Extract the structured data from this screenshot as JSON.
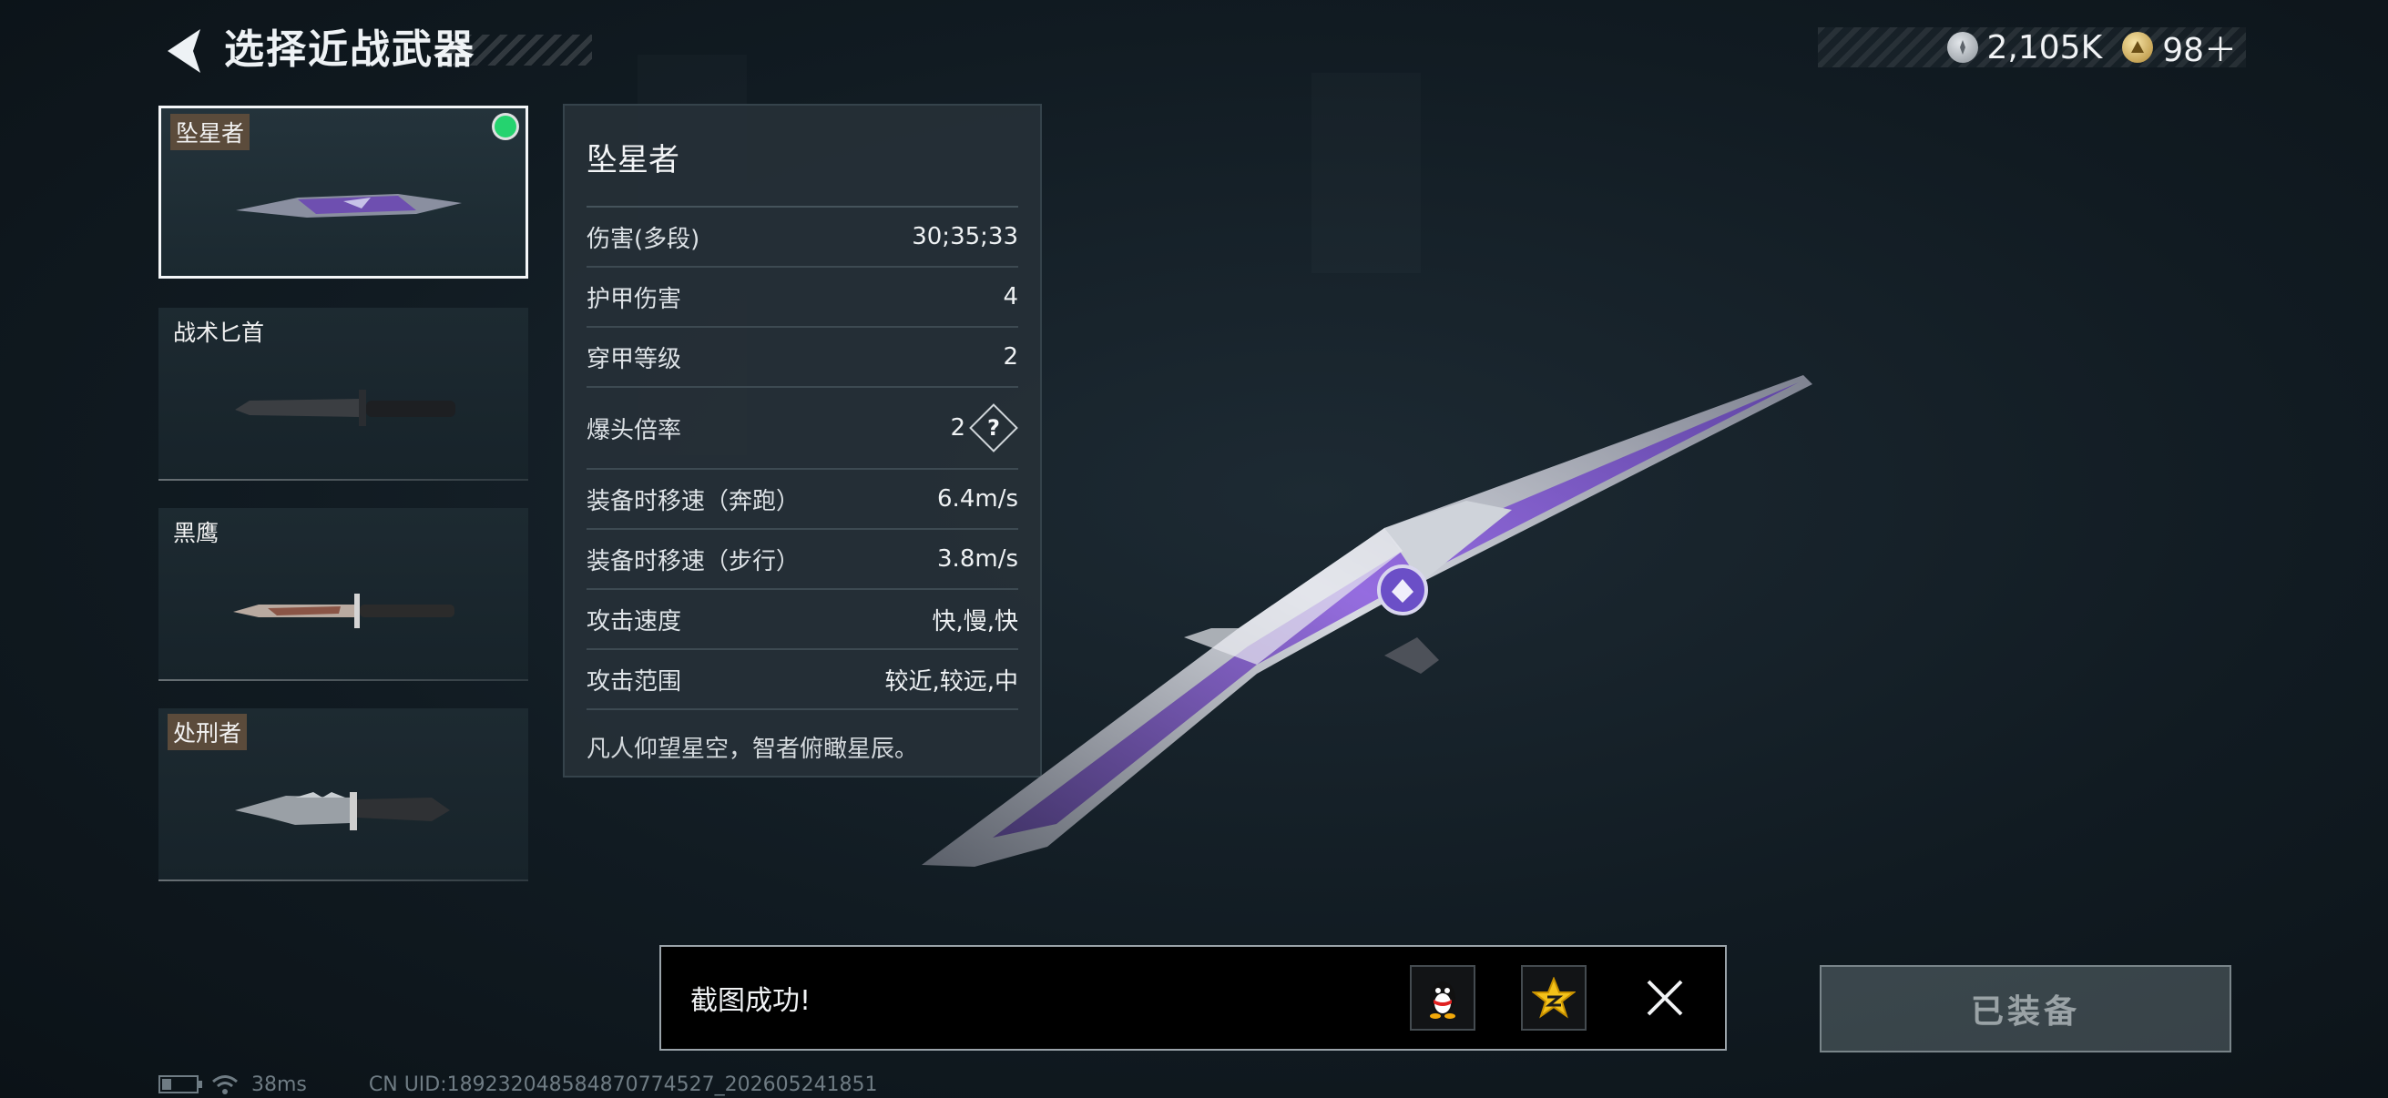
{
  "header": {
    "title": "选择近战武器",
    "back_icon": "back-arrow-icon"
  },
  "currency": [
    {
      "icon": "silver-coin-icon",
      "value": "2,105K"
    },
    {
      "icon": "gold-coin-icon",
      "value": "98＋"
    }
  ],
  "weapons": [
    {
      "name": "坠星者",
      "selected": true,
      "equipped": true
    },
    {
      "name": "战术匕首",
      "selected": false,
      "equipped": false
    },
    {
      "name": "黑鹰",
      "selected": false,
      "equipped": false
    },
    {
      "name": "处刑者",
      "selected": false,
      "equipped": false
    }
  ],
  "stats": {
    "name": "坠星者",
    "rows": [
      {
        "label": "伤害(多段)",
        "value": "30;35;33"
      },
      {
        "label": "护甲伤害",
        "value": "4"
      },
      {
        "label": "穿甲等级",
        "value": "2"
      },
      {
        "label": "爆头倍率",
        "value": "2"
      },
      {
        "label": "装备时移速（奔跑）",
        "value": "6.4m/s"
      },
      {
        "label": "装备时移速（步行）",
        "value": "3.8m/s"
      },
      {
        "label": "攻击速度",
        "value": "快,慢,快"
      },
      {
        "label": "攻击范围",
        "value": "较近,较远,中"
      }
    ],
    "help_mark": "?",
    "description": "凡人仰望星空，智者俯瞰星辰。"
  },
  "toast": {
    "text": "截图成功!",
    "share_qq_icon": "qq-penguin-icon",
    "share_qzone_icon": "qzone-star-icon",
    "close_icon": "close-icon"
  },
  "equip_button": {
    "label": "已装备"
  },
  "footer": {
    "ping": "38ms",
    "uid": "CN UID:18923204858487077452​7_202605241851"
  },
  "colors": {
    "equipped_dot": "#25d36f",
    "accent_purple": "#7b4fd6",
    "panel_bg": "#263037"
  }
}
